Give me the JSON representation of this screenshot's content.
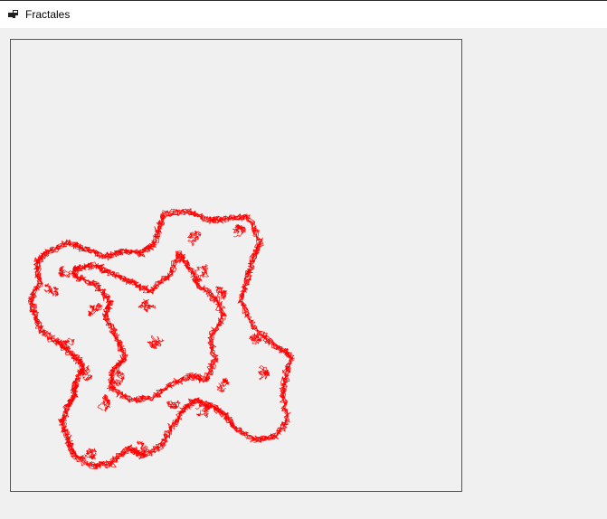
{
  "window": {
    "title": "Fractales",
    "icon": "app-window-icon"
  },
  "fractal": {
    "type": "koch-island-random-walk",
    "stroke_color": "#ff0000",
    "background_color": "#f0f0f0",
    "border_color": "#555555"
  }
}
